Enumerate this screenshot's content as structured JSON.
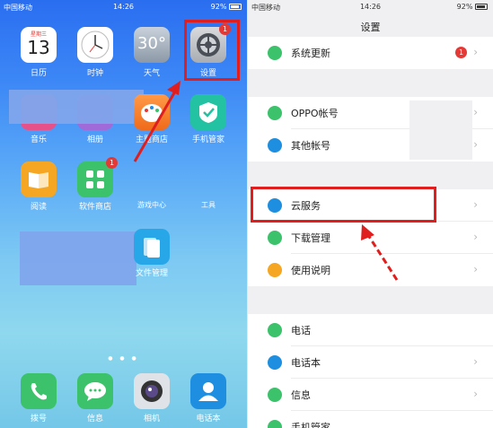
{
  "left": {
    "status": {
      "carrier": "中国移动",
      "time": "14:26",
      "battery": "92%"
    },
    "apps": {
      "calendar": {
        "label": "日历",
        "weekday": "星期三",
        "day": "13"
      },
      "clock": {
        "label": "时钟"
      },
      "weather": {
        "label": "天气",
        "temp": "30°"
      },
      "settings": {
        "label": "设置",
        "badge": "1"
      },
      "music": {
        "label": "音乐"
      },
      "gallery": {
        "label": "相册"
      },
      "theme_store": {
        "label": "主题商店"
      },
      "phone_manager": {
        "label": "手机管家"
      },
      "reader": {
        "label": "阅读"
      },
      "app_store": {
        "label": "软件商店",
        "badge": "1"
      },
      "game_center": {
        "label": "游戏中心"
      },
      "tools": {
        "label": "工具"
      },
      "files": {
        "label": "文件管理"
      }
    },
    "dock": {
      "dial": {
        "label": "拨号"
      },
      "message": {
        "label": "信息"
      },
      "camera": {
        "label": "相机"
      },
      "contacts": {
        "label": "电话本"
      }
    },
    "page_dots": "● ● ●"
  },
  "right": {
    "status": {
      "carrier": "中国移动",
      "time": "14:26",
      "battery": "92%"
    },
    "title": "设置",
    "items": [
      {
        "label": "系统更新",
        "badge": "1",
        "color": "#3cc26b"
      },
      {
        "label": "OPPO帐号",
        "color": "#3cc26b"
      },
      {
        "label": "其他帐号",
        "color": "#1e8fe0"
      },
      {
        "label": "云服务",
        "color": "#1e8fe0"
      },
      {
        "label": "下载管理",
        "color": "#3cc26b"
      },
      {
        "label": "使用说明",
        "color": "#f5a623"
      },
      {
        "label": "电话",
        "color": "#3cc26b"
      },
      {
        "label": "电话本",
        "color": "#1e8fe0"
      },
      {
        "label": "信息",
        "color": "#3cc26b"
      },
      {
        "label": "手机管家",
        "color": "#3cc26b"
      }
    ],
    "chevron": "›"
  },
  "colors": {
    "highlight": "#e01e1e",
    "accent_green": "#3cc26b",
    "accent_blue": "#1e8fe0"
  }
}
